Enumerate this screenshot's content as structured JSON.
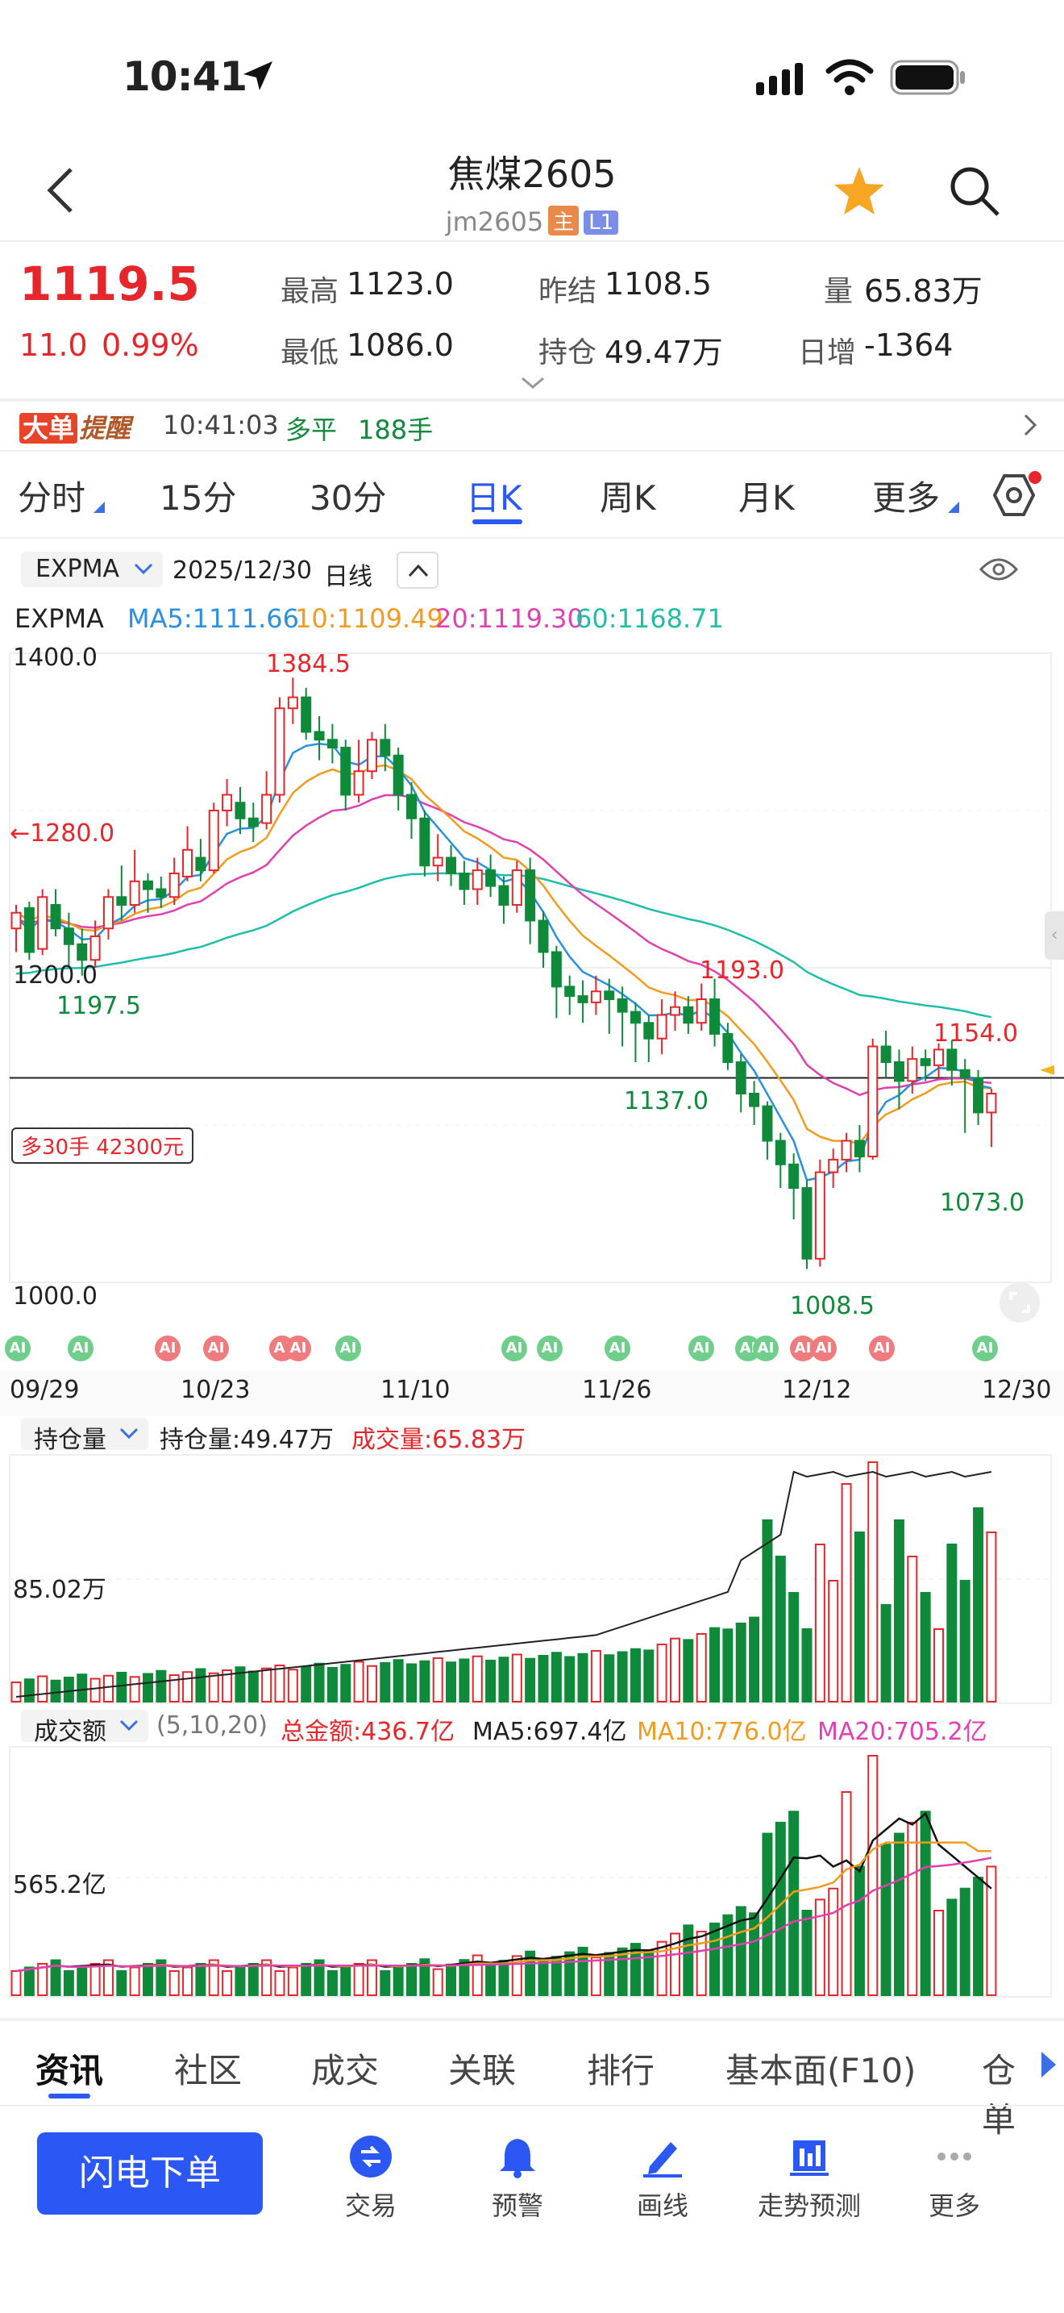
{
  "status_bar": {
    "time": "10:41"
  },
  "header": {
    "title": "焦煤2605",
    "code": "jm2605",
    "badge_main": "主",
    "badge_level": "L1"
  },
  "quote": {
    "price": "1119.5",
    "change": "11.0",
    "change_pct": "0.99%",
    "high_label": "最高",
    "high": "1123.0",
    "low_label": "最低",
    "low": "1086.0",
    "prev_label": "昨结",
    "prev": "1108.5",
    "oi_label": "持仓",
    "oi": "49.47万",
    "vol_label": "量",
    "vol": "65.83万",
    "daily_label": "日增",
    "daily": "-1364"
  },
  "alert": {
    "badge1": "大单",
    "badge2": "提醒",
    "time": "10:41:03",
    "type": "多平",
    "size": "188手"
  },
  "period_tabs": [
    "分时",
    "15分",
    "30分",
    "日K",
    "周K",
    "月K",
    "更多"
  ],
  "chart_header": {
    "indicator": "EXPMA",
    "date": "2025/12/30",
    "period": "日线"
  },
  "ma_legend": {
    "name": "EXPMA",
    "ma5": "MA5:1111.66",
    "ma10": "10:1109.49",
    "ma20": "20:1119.30",
    "ma60": "60:1168.71"
  },
  "position_label": "多30手 42300元",
  "ai_label": "AI",
  "chart_labels": {
    "y_top": "1400.0",
    "y_mid": "1200.0",
    "y_bottom": "1000.0",
    "hi1": "1384.5",
    "hi2": "1280.0",
    "hi3": "1193.0",
    "hi4": "1154.0",
    "lo1": "1197.5",
    "lo2": "1137.0",
    "lo3": "1008.5",
    "lo4": "1073.0"
  },
  "x_dates": [
    "09/29",
    "10/23",
    "11/10",
    "11/26",
    "12/12",
    "12/30"
  ],
  "oi_panel": {
    "selector": "持仓量",
    "oi_text": "持仓量:49.47万",
    "vol_text": "成交量:65.83万",
    "y_label": "85.02万"
  },
  "amt_panel": {
    "selector": "成交额",
    "params": "(5,10,20)",
    "total": "总金额:436.7亿",
    "ma5": "MA5:697.4亿",
    "ma10": "MA10:776.0亿",
    "ma20": "MA20:705.2亿",
    "y_label": "565.2亿"
  },
  "bottom_tabs": [
    "资讯",
    "社区",
    "成交",
    "关联",
    "排行",
    "基本面(F10)",
    "仓单"
  ],
  "toolbar": {
    "order_button": "闪电下单",
    "trade": "交易",
    "alarm": "预警",
    "draw": "画线",
    "forecast": "走势预测",
    "more": "更多"
  },
  "colors": {
    "up": "#e5262b",
    "down": "#0f8a3a",
    "ma5": "#2a90e0",
    "ma10": "#f29b1d",
    "ma20": "#e040b0",
    "ma60": "#1dbfa8",
    "accent": "#2b57f5"
  },
  "chart_data": {
    "type": "candlestick",
    "ylim": [
      1000,
      1400
    ],
    "candles": [
      [
        1225,
        1235,
        1240,
        1210
      ],
      [
        1238,
        1210,
        1242,
        1205
      ],
      [
        1212,
        1245,
        1250,
        1208
      ],
      [
        1240,
        1225,
        1250,
        1220
      ],
      [
        1225,
        1215,
        1235,
        1200
      ],
      [
        1215,
        1205,
        1225,
        1195
      ],
      [
        1205,
        1220,
        1230,
        1200
      ],
      [
        1225,
        1245,
        1250,
        1218
      ],
      [
        1245,
        1240,
        1265,
        1230
      ],
      [
        1240,
        1255,
        1275,
        1235
      ],
      [
        1255,
        1250,
        1260,
        1235
      ],
      [
        1250,
        1245,
        1258,
        1238
      ],
      [
        1245,
        1260,
        1270,
        1240
      ],
      [
        1258,
        1275,
        1290,
        1255
      ],
      [
        1270,
        1262,
        1282,
        1255
      ],
      [
        1262,
        1300,
        1305,
        1260
      ],
      [
        1300,
        1310,
        1320,
        1290
      ],
      [
        1305,
        1295,
        1315,
        1285
      ],
      [
        1295,
        1290,
        1305,
        1280
      ],
      [
        1292,
        1310,
        1325,
        1288
      ],
      [
        1310,
        1365,
        1372,
        1305
      ],
      [
        1365,
        1372,
        1384.5,
        1355
      ],
      [
        1372,
        1350,
        1378,
        1345
      ],
      [
        1350,
        1345,
        1360,
        1332
      ],
      [
        1345,
        1340,
        1355,
        1330
      ],
      [
        1340,
        1310,
        1345,
        1300
      ],
      [
        1310,
        1325,
        1345,
        1305
      ],
      [
        1325,
        1345,
        1350,
        1320
      ],
      [
        1345,
        1335,
        1355,
        1325
      ],
      [
        1335,
        1310,
        1340,
        1300
      ],
      [
        1310,
        1295,
        1318,
        1282
      ],
      [
        1295,
        1265,
        1300,
        1258
      ],
      [
        1265,
        1270,
        1285,
        1255
      ],
      [
        1270,
        1260,
        1278,
        1252
      ],
      [
        1260,
        1250,
        1268,
        1240
      ],
      [
        1250,
        1262,
        1270,
        1240
      ],
      [
        1262,
        1252,
        1272,
        1245
      ],
      [
        1252,
        1240,
        1258,
        1228
      ],
      [
        1240,
        1262,
        1268,
        1235
      ],
      [
        1262,
        1230,
        1270,
        1215
      ],
      [
        1230,
        1210,
        1236,
        1200
      ],
      [
        1210,
        1188,
        1214,
        1168
      ],
      [
        1188,
        1182,
        1195,
        1170
      ],
      [
        1182,
        1178,
        1192,
        1165
      ],
      [
        1178,
        1185,
        1195,
        1170
      ],
      [
        1185,
        1180,
        1193,
        1158
      ],
      [
        1180,
        1172,
        1188,
        1150
      ],
      [
        1172,
        1165,
        1178,
        1140
      ],
      [
        1165,
        1155,
        1170,
        1140
      ],
      [
        1155,
        1170,
        1180,
        1145
      ],
      [
        1170,
        1175,
        1185,
        1160
      ],
      [
        1175,
        1165,
        1182,
        1158
      ],
      [
        1165,
        1180,
        1190,
        1160
      ],
      [
        1180,
        1158,
        1193,
        1150
      ],
      [
        1158,
        1140,
        1165,
        1135
      ],
      [
        1140,
        1120,
        1145,
        1108
      ],
      [
        1120,
        1112,
        1128,
        1100
      ],
      [
        1112,
        1090,
        1115,
        1078
      ],
      [
        1090,
        1075,
        1095,
        1060
      ],
      [
        1075,
        1060,
        1082,
        1040
      ],
      [
        1060,
        1015,
        1065,
        1008.5
      ],
      [
        1015,
        1070,
        1078,
        1010
      ],
      [
        1070,
        1078,
        1085,
        1060
      ],
      [
        1078,
        1090,
        1095,
        1070
      ],
      [
        1090,
        1080,
        1100,
        1070
      ],
      [
        1080,
        1150,
        1155,
        1078
      ],
      [
        1150,
        1140,
        1160,
        1130
      ],
      [
        1140,
        1128,
        1148,
        1110
      ],
      [
        1128,
        1142,
        1150,
        1120
      ],
      [
        1142,
        1138,
        1148,
        1128
      ],
      [
        1138,
        1148,
        1152,
        1130
      ],
      [
        1148,
        1135,
        1154,
        1125
      ],
      [
        1135,
        1130,
        1142,
        1095
      ],
      [
        1130,
        1108,
        1135,
        1100
      ],
      [
        1108,
        1120,
        1123,
        1086
      ]
    ],
    "ema5_end": 1111.66,
    "ema10_end": 1109.49,
    "ema20_end": 1119.3,
    "ema60_end": 1168.71
  }
}
